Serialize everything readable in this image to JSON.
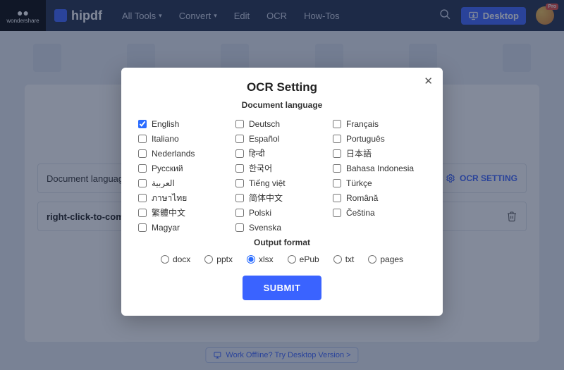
{
  "header": {
    "vendor_top": "●●",
    "vendor": "wondershare",
    "brand": "hipdf",
    "nav": {
      "all_tools": "All Tools",
      "convert": "Convert",
      "edit": "Edit",
      "ocr": "OCR",
      "howtos": "How-Tos"
    },
    "desktop_btn": "Desktop",
    "avatar_badge": "Pro"
  },
  "bg": {
    "row1_label": "Document language",
    "ocr_setting": "OCR SETTING",
    "row2_label": "right-click-to-com"
  },
  "bottom_link": "Work Offline? Try Desktop Version >",
  "modal": {
    "title": "OCR Setting",
    "subtitle": "Document language",
    "languages": [
      {
        "label": "English",
        "checked": true
      },
      {
        "label": "Deutsch"
      },
      {
        "label": "Français"
      },
      {
        "label": "Italiano"
      },
      {
        "label": "Español"
      },
      {
        "label": "Português"
      },
      {
        "label": "Nederlands"
      },
      {
        "label": "हिन्दी"
      },
      {
        "label": "日本語"
      },
      {
        "label": "Русский"
      },
      {
        "label": "한국어"
      },
      {
        "label": "Bahasa Indonesia"
      },
      {
        "label": "العربية"
      },
      {
        "label": "Tiếng việt"
      },
      {
        "label": "Türkçe"
      },
      {
        "label": "ภาษาไทย"
      },
      {
        "label": "简体中文"
      },
      {
        "label": "Română"
      },
      {
        "label": "繁體中文"
      },
      {
        "label": "Polski"
      },
      {
        "label": "Čeština"
      },
      {
        "label": "Magyar"
      },
      {
        "label": "Svenska"
      }
    ],
    "output_title": "Output format",
    "formats": [
      {
        "label": "docx"
      },
      {
        "label": "pptx"
      },
      {
        "label": "xlsx",
        "checked": true
      },
      {
        "label": "ePub"
      },
      {
        "label": "txt"
      },
      {
        "label": "pages"
      }
    ],
    "submit": "SUBMIT"
  }
}
